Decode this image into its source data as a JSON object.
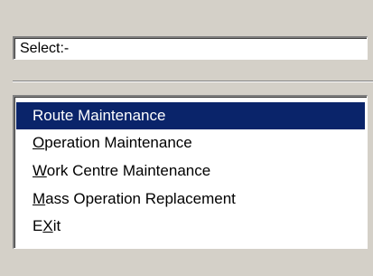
{
  "select_field": {
    "value": "Select:-"
  },
  "menu": {
    "items": [
      {
        "pre": "Route Maintenance",
        "accel": "",
        "post": "",
        "selected": true
      },
      {
        "pre": "",
        "accel": "O",
        "post": "peration Maintenance",
        "selected": false
      },
      {
        "pre": "",
        "accel": "W",
        "post": "ork Centre Maintenance",
        "selected": false
      },
      {
        "pre": "",
        "accel": "M",
        "post": "ass Operation Replacement",
        "selected": false
      },
      {
        "pre": "E",
        "accel": "X",
        "post": "it",
        "selected": false
      }
    ],
    "selection_color": "#0a246a",
    "selection_text_color": "#ffffff"
  },
  "colors": {
    "window_background": "#d4d0c8",
    "field_background": "#ffffff"
  }
}
